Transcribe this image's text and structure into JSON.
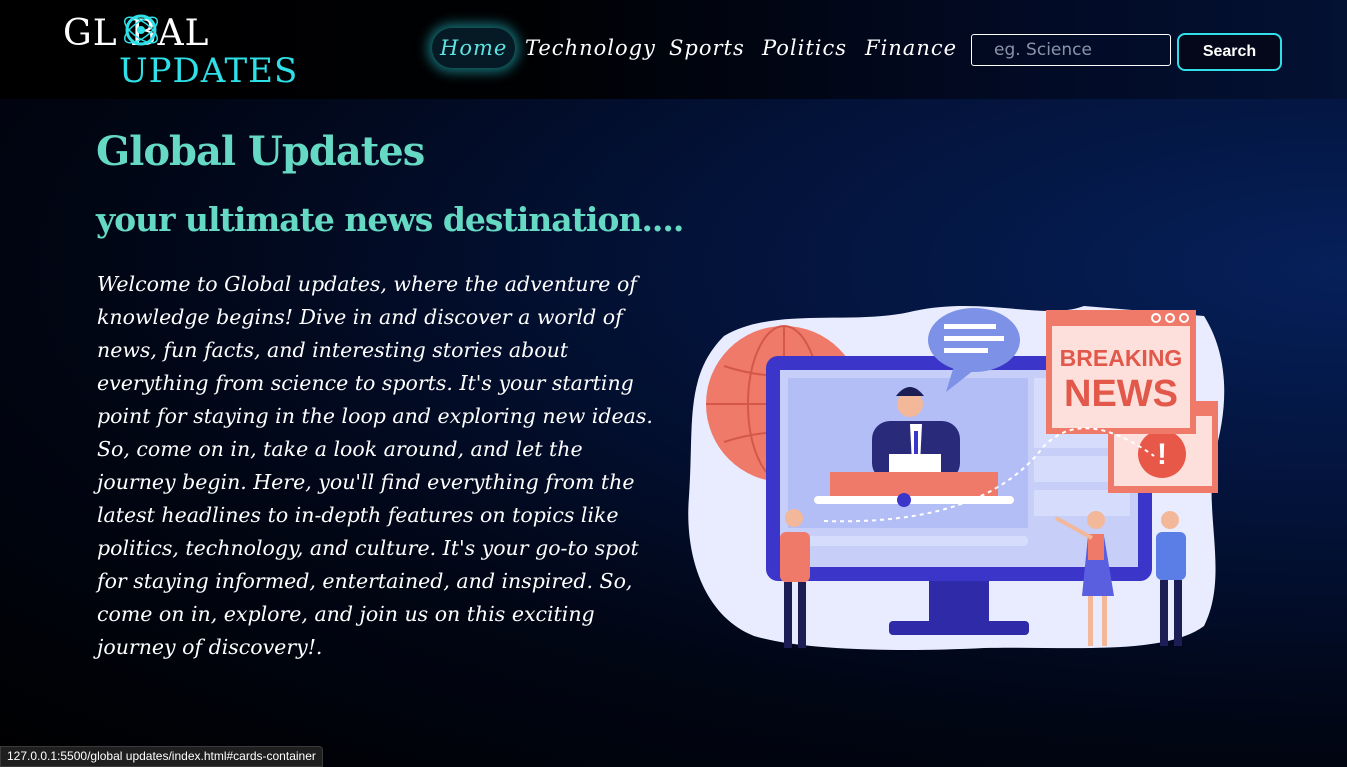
{
  "logo": {
    "line1": "GL BAL",
    "line2": "UPDATES"
  },
  "nav": {
    "items": [
      {
        "label": "Home",
        "active": true
      },
      {
        "label": "Technology",
        "active": false
      },
      {
        "label": "Sports",
        "active": false
      },
      {
        "label": "Politics",
        "active": false
      },
      {
        "label": "Finance",
        "active": false
      }
    ]
  },
  "search": {
    "placeholder": "eg. Science",
    "value": "",
    "button_label": "Search"
  },
  "hero": {
    "title": "Global Updates",
    "subtitle": "your ultimate news destination....",
    "body": "Welcome to Global updates, where the adventure of knowledge begins! Dive in and discover a world of news, fun facts, and interesting stories about everything from science to sports. It's your starting point for staying in the loop and exploring new ideas. So, come on in, take a look around, and let the journey begin. Here, you'll find everything from the latest headlines to in-depth features on topics like politics, technology, and culture. It's your go-to spot for staying informed, entertained, and inspired. So, come on in, explore, and join us on this exciting journey of discovery!."
  },
  "illustration": {
    "sign_line1": "BREAKING",
    "sign_line2": "NEWS",
    "alert_mark": "!"
  },
  "status_bar": {
    "url": "127.0.0.1:5500/global updates/index.html#cards-container"
  },
  "colors": {
    "accent_cyan": "#2fe0e8",
    "heading_teal": "#66d9c4",
    "coral": "#f07a6a",
    "monitor_blue": "#3b36c9"
  }
}
